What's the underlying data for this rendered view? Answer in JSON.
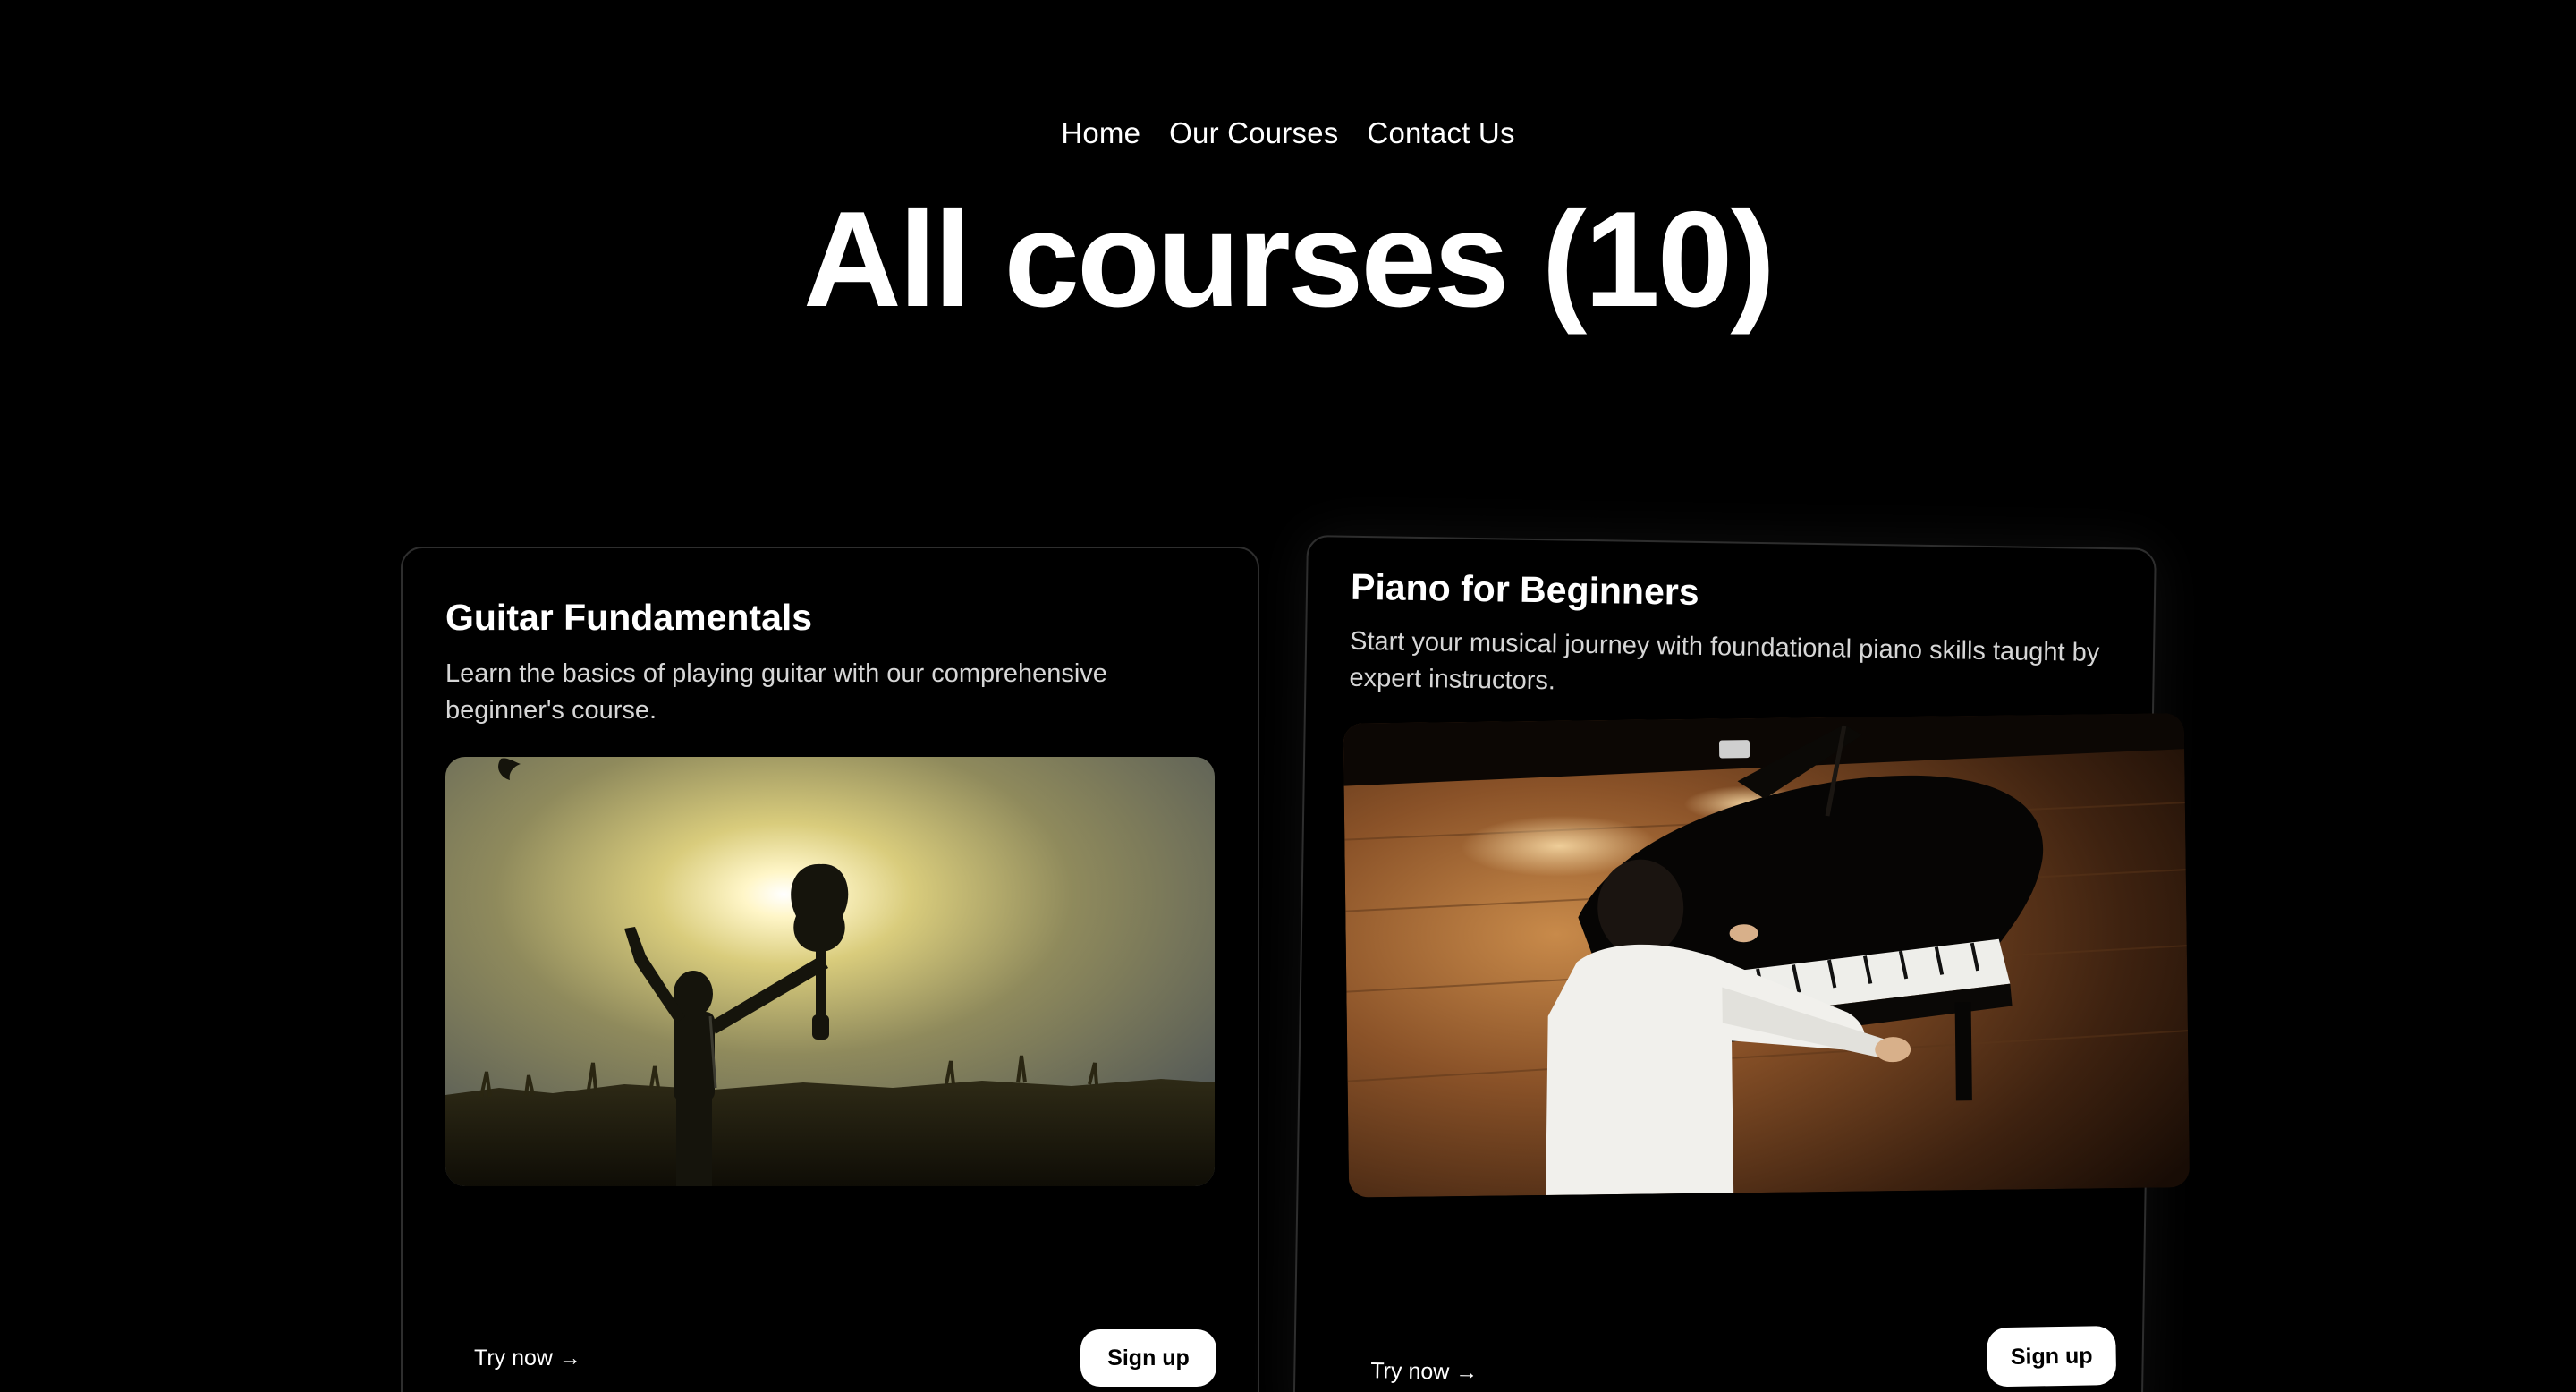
{
  "nav": {
    "items": [
      {
        "label": "Home"
      },
      {
        "label": "Our Courses"
      },
      {
        "label": "Contact Us"
      }
    ]
  },
  "headline": "All courses (10)",
  "courses": [
    {
      "title": "Guitar Fundamentals",
      "description": "Learn the basics of playing guitar with our comprehensive beginner's course.",
      "image_icon": "guitar-silhouette-image",
      "try_label": "Try now →",
      "signup_label": "Sign up"
    },
    {
      "title": "Piano for Beginners",
      "description": "Start your musical journey with foundational piano skills taught by expert instructors.",
      "image_icon": "piano-player-image",
      "try_label": "Try now →",
      "signup_label": "Sign up"
    }
  ],
  "colors": {
    "background": "#000000",
    "text": "#ffffff",
    "muted_text": "#d6d6d6",
    "card_border": "#2e2e2e",
    "button_bg": "#ffffff",
    "button_text": "#000000"
  }
}
